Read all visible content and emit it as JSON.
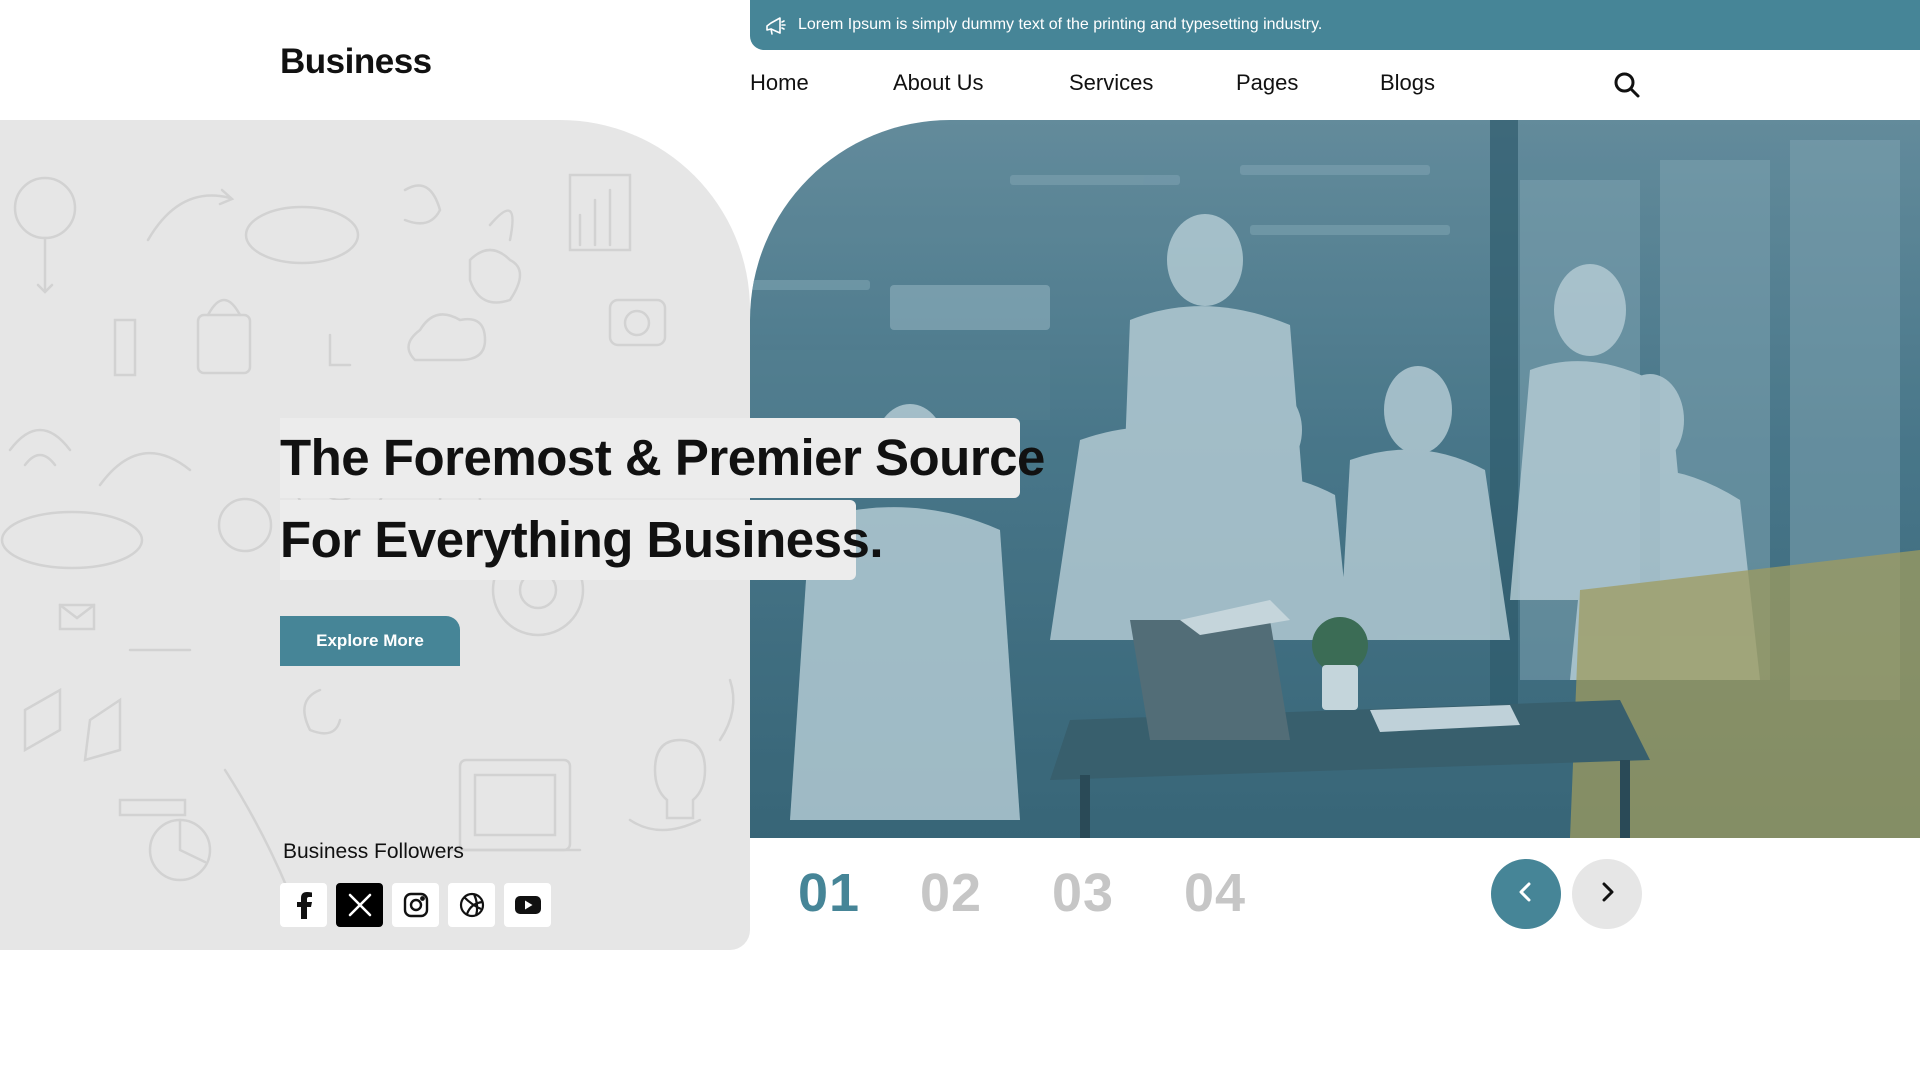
{
  "topbar": {
    "icon": "megaphone-icon",
    "message": "Lorem Ipsum is simply dummy text of the printing and typesetting industry."
  },
  "header": {
    "logo": "Business",
    "nav": [
      {
        "label": "Home"
      },
      {
        "label": "About Us"
      },
      {
        "label": "Services"
      },
      {
        "label": "Pages"
      },
      {
        "label": "Blogs"
      }
    ],
    "search_icon": "search-icon"
  },
  "hero": {
    "headline_line1": "The Foremost & Premier Source",
    "headline_line2": "For Everything Business.",
    "cta_label": "Explore More",
    "followers_title": "Business Followers",
    "socials": [
      "facebook-icon",
      "x-icon",
      "instagram-icon",
      "dribbble-icon",
      "youtube-icon"
    ],
    "slides": [
      "01",
      "02",
      "03",
      "04"
    ],
    "active_slide": "01",
    "prev_icon": "chevron-left-icon",
    "next_icon": "chevron-right-icon"
  },
  "colors": {
    "accent": "#468597",
    "panel": "#e6e6e6",
    "inactive_number": "#c6c6c6"
  }
}
